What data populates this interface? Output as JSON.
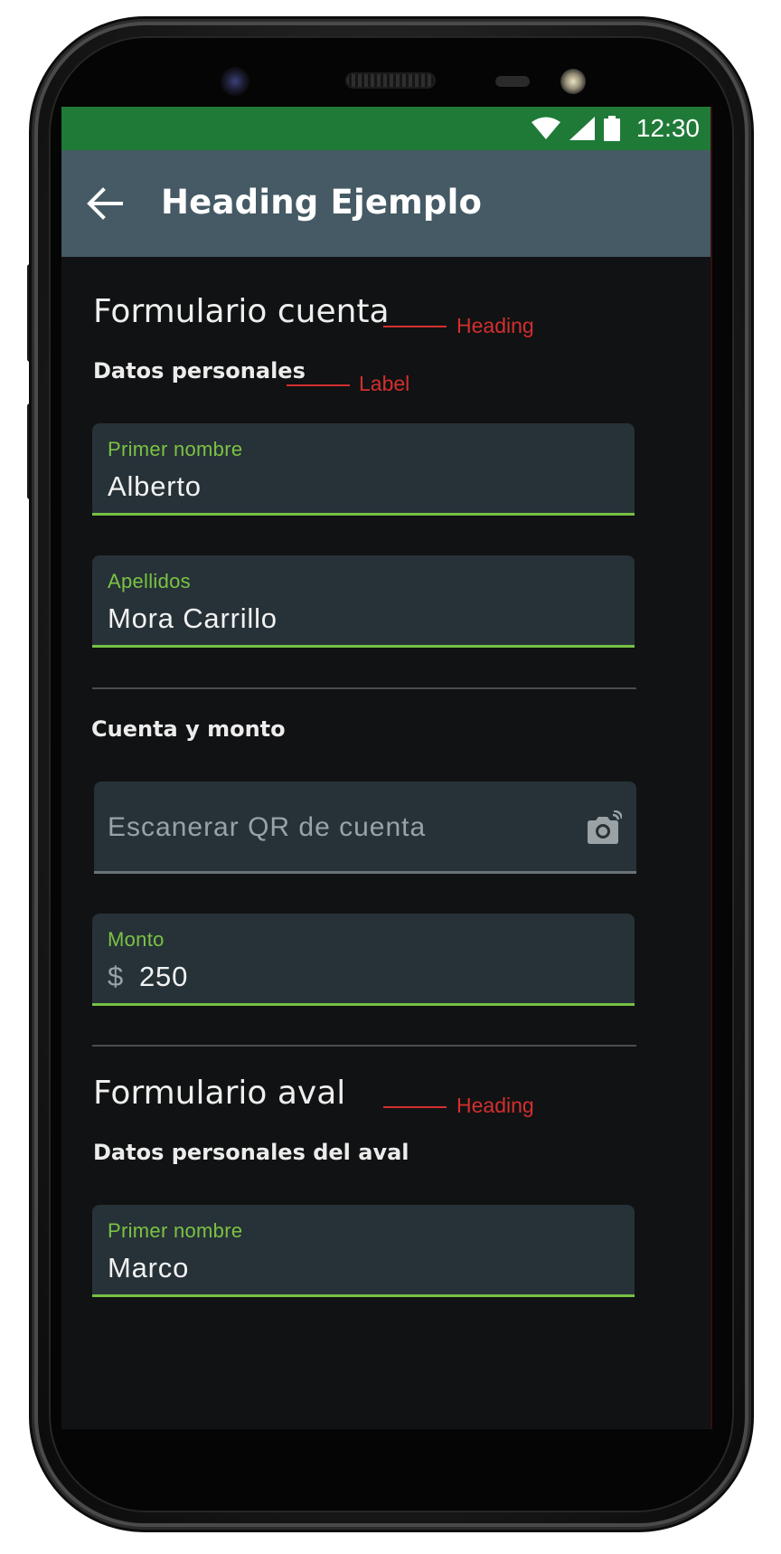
{
  "status_bar": {
    "time": "12:30",
    "icons": [
      "wifi-icon",
      "cellular-signal-icon",
      "battery-icon"
    ]
  },
  "app_bar": {
    "back_icon": "arrow-back-icon",
    "title": "Heading Ejemplo"
  },
  "form_cuenta": {
    "heading": "Formulario cuenta",
    "heading_annotation": "Heading",
    "personal_label": "Datos personales",
    "personal_label_annotation": "Label",
    "first_name": {
      "label": "Primer nombre",
      "value": "Alberto"
    },
    "last_name": {
      "label": "Apellidos",
      "value": "Mora Carrillo"
    },
    "account_label": "Cuenta y monto",
    "qr_field": {
      "placeholder": "Escanerar QR de cuenta",
      "icon": "camera-icon"
    },
    "amount": {
      "label": "Monto",
      "prefix": "$",
      "value": "250"
    }
  },
  "form_aval": {
    "heading": "Formulario aval",
    "heading_annotation": "Heading",
    "personal_label": "Datos personales del aval",
    "first_name": {
      "label": "Primer nombre",
      "value": "Marco"
    }
  },
  "colors": {
    "status_bar": "#1f7a38",
    "app_bar": "#455a64",
    "background": "#111213",
    "field_background": "#263238",
    "accent_green": "#76c043",
    "annotation_red": "#d32f2f"
  }
}
